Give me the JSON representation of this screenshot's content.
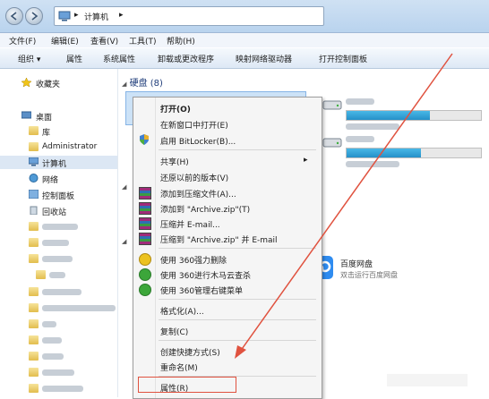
{
  "address": {
    "segment": "计算机"
  },
  "menu": [
    "文件(F)",
    "编辑(E)",
    "查看(V)",
    "工具(T)",
    "帮助(H)"
  ],
  "toolbar": [
    "组织 ▾",
    "属性",
    "系统属性",
    "卸载或更改程序",
    "映射网络驱动器",
    "打开控制面板"
  ],
  "sidebar": {
    "favorites": "收藏夹",
    "desktop": "桌面",
    "library": "库",
    "user": "Administrator",
    "computer": "计算机",
    "network": "网络",
    "control_panel": "控制面板",
    "recycle": "回收站"
  },
  "sections": {
    "hard_disk": "硬盘 (8)"
  },
  "drives": [
    {
      "fill_pct": 62
    },
    {
      "fill_pct": 55
    }
  ],
  "baidu": {
    "name": "百度网盘",
    "desc": "双击运行百度网盘"
  },
  "context_menu": {
    "items": [
      {
        "label": "打开(O)",
        "bold": true
      },
      {
        "label": "在新窗口中打开(E)"
      },
      {
        "label": "启用 BitLocker(B)..."
      },
      {
        "label": "共享(H)",
        "arrow": "▸"
      },
      {
        "label": "还原以前的版本(V)"
      },
      {
        "label": "添加到压缩文件(A)..."
      },
      {
        "label": "添加到 \"Archive.zip\"(T)"
      },
      {
        "label": "压缩并 E-mail..."
      },
      {
        "label": "压缩到 \"Archive.zip\" 并 E-mail"
      },
      {
        "label": "使用 360强力删除"
      },
      {
        "label": "使用 360进行木马云查杀"
      },
      {
        "label": "使用 360管理右键菜单"
      },
      {
        "label": "格式化(A)..."
      },
      {
        "label": "复制(C)"
      },
      {
        "label": "创建快捷方式(S)"
      },
      {
        "label": "重命名(M)"
      },
      {
        "label": "属性(R)"
      }
    ]
  },
  "colors": {
    "arrow": "#e0523f",
    "accent": "#2590c8"
  }
}
